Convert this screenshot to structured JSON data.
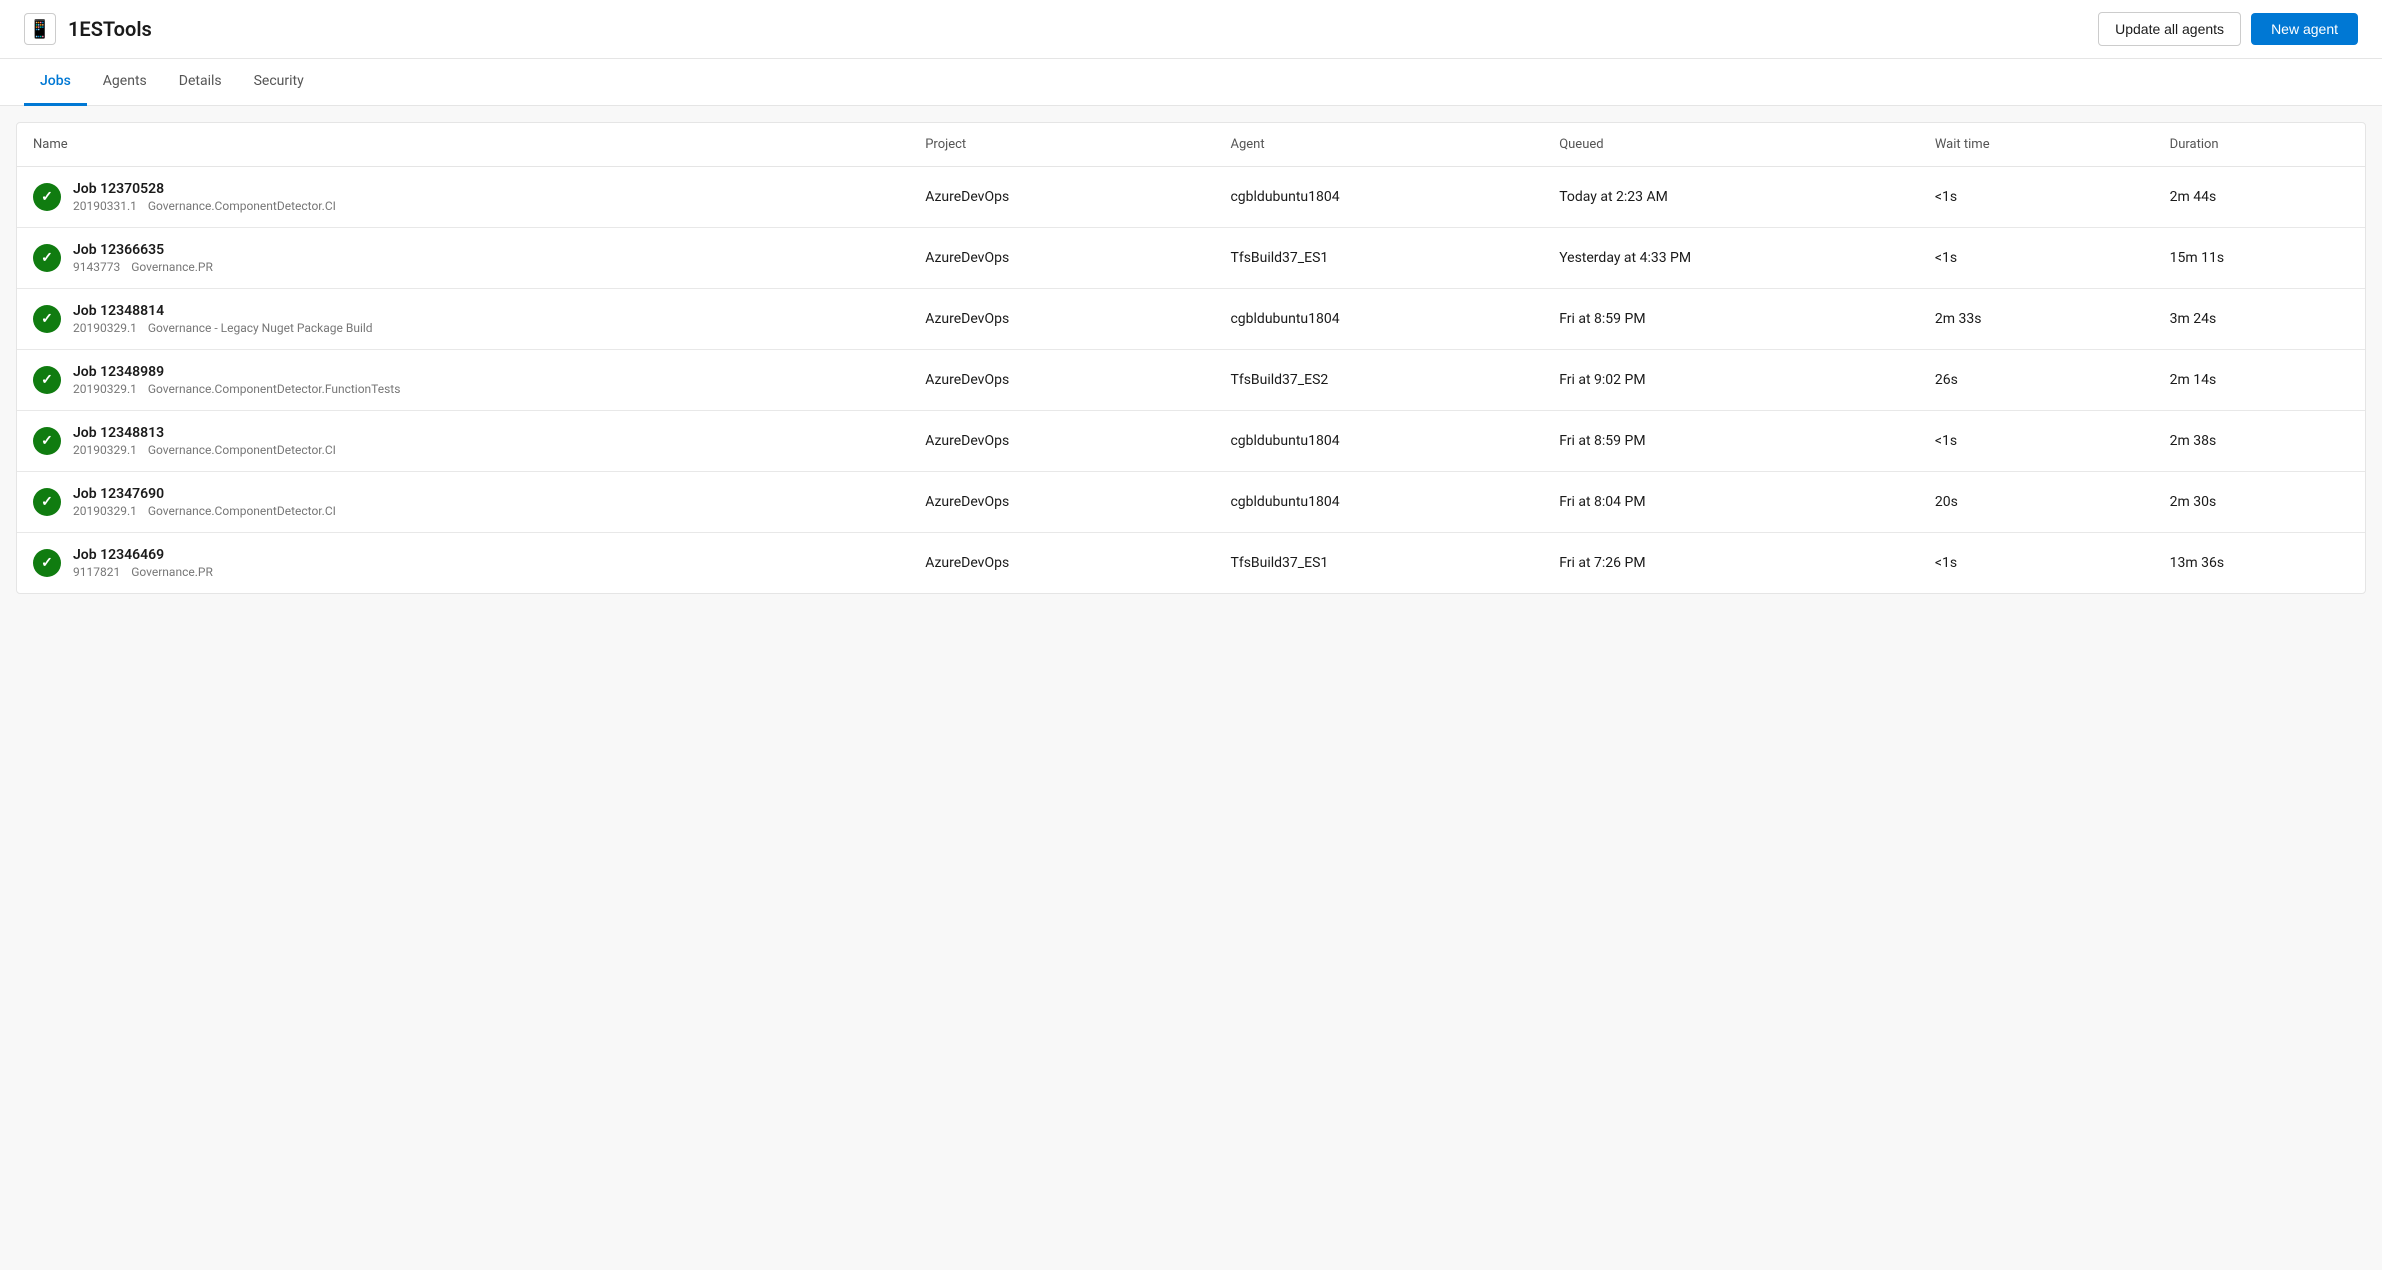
{
  "app": {
    "title": "1ESTools",
    "icon": "📱"
  },
  "header": {
    "update_all_label": "Update all agents",
    "new_agent_label": "New agent"
  },
  "tabs": [
    {
      "id": "jobs",
      "label": "Jobs",
      "active": true
    },
    {
      "id": "agents",
      "label": "Agents",
      "active": false
    },
    {
      "id": "details",
      "label": "Details",
      "active": false
    },
    {
      "id": "security",
      "label": "Security",
      "active": false
    }
  ],
  "table": {
    "columns": [
      {
        "id": "name",
        "label": "Name"
      },
      {
        "id": "project",
        "label": "Project"
      },
      {
        "id": "agent",
        "label": "Agent"
      },
      {
        "id": "queued",
        "label": "Queued"
      },
      {
        "id": "wait_time",
        "label": "Wait time"
      },
      {
        "id": "duration",
        "label": "Duration"
      }
    ],
    "rows": [
      {
        "id": "job-12370528",
        "name": "Job 12370528",
        "build_num": "20190331.1",
        "pipeline": "Governance.ComponentDetector.CI",
        "project": "AzureDevOps",
        "agent": "cgbldubuntu1804",
        "queued": "Today at 2:23 AM",
        "wait_time": "<1s",
        "duration": "2m 44s",
        "status": "success"
      },
      {
        "id": "job-12366635",
        "name": "Job 12366635",
        "build_num": "9143773",
        "pipeline": "Governance.PR",
        "project": "AzureDevOps",
        "agent": "TfsBuild37_ES1",
        "queued": "Yesterday at 4:33 PM",
        "wait_time": "<1s",
        "duration": "15m 11s",
        "status": "success"
      },
      {
        "id": "job-12348814",
        "name": "Job 12348814",
        "build_num": "20190329.1",
        "pipeline": "Governance - Legacy Nuget Package Build",
        "project": "AzureDevOps",
        "agent": "cgbldubuntu1804",
        "queued": "Fri at 8:59 PM",
        "wait_time": "2m 33s",
        "duration": "3m 24s",
        "status": "success"
      },
      {
        "id": "job-12348989",
        "name": "Job 12348989",
        "build_num": "20190329.1",
        "pipeline": "Governance.ComponentDetector.FunctionTests",
        "project": "AzureDevOps",
        "agent": "TfsBuild37_ES2",
        "queued": "Fri at 9:02 PM",
        "wait_time": "26s",
        "duration": "2m 14s",
        "status": "success"
      },
      {
        "id": "job-12348813",
        "name": "Job 12348813",
        "build_num": "20190329.1",
        "pipeline": "Governance.ComponentDetector.CI",
        "project": "AzureDevOps",
        "agent": "cgbldubuntu1804",
        "queued": "Fri at 8:59 PM",
        "wait_time": "<1s",
        "duration": "2m 38s",
        "status": "success"
      },
      {
        "id": "job-12347690",
        "name": "Job 12347690",
        "build_num": "20190329.1",
        "pipeline": "Governance.ComponentDetector.CI",
        "project": "AzureDevOps",
        "agent": "cgbldubuntu1804",
        "queued": "Fri at 8:04 PM",
        "wait_time": "20s",
        "duration": "2m 30s",
        "status": "success"
      },
      {
        "id": "job-12346469",
        "name": "Job 12346469",
        "build_num": "9117821",
        "pipeline": "Governance.PR",
        "project": "AzureDevOps",
        "agent": "TfsBuild37_ES1",
        "queued": "Fri at 7:26 PM",
        "wait_time": "<1s",
        "duration": "13m 36s",
        "status": "success"
      }
    ]
  }
}
